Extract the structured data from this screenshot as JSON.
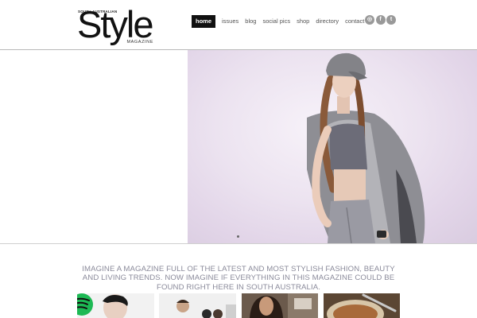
{
  "logo": {
    "region": "SOUTH AUSTRALIAN",
    "word": "Style",
    "subtitle": "MAGAZINE"
  },
  "nav": {
    "items": [
      {
        "label": "home",
        "active": true
      },
      {
        "label": "issues",
        "active": false
      },
      {
        "label": "blog",
        "active": false
      },
      {
        "label": "social pics",
        "active": false
      },
      {
        "label": "shop",
        "active": false
      },
      {
        "label": "directory",
        "active": false
      },
      {
        "label": "contact",
        "active": false
      }
    ]
  },
  "social": {
    "icons": [
      {
        "name": "instagram-icon",
        "glyph": "◎"
      },
      {
        "name": "facebook-icon",
        "glyph": "f"
      },
      {
        "name": "twitter-icon",
        "glyph": "t"
      }
    ]
  },
  "hero": {
    "slide_indicator": "1"
  },
  "tagline": {
    "text": "IMAGINE A MAGAZINE FULL OF THE LATEST AND MOST STYLISH FASHION, BEAUTY AND LIVING TRENDS. NOW IMAGINE IF EVERYTHING IN THIS MAGAZINE COULD BE FOUND RIGHT HERE IN SOUTH AUSTRALIA."
  },
  "colors": {
    "nav_active_bg": "#111111",
    "tagline": "#8a8a9a",
    "spotify_green": "#1db954"
  }
}
